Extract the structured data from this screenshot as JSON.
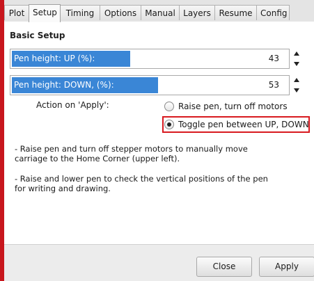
{
  "tabs": [
    {
      "label": "Plot",
      "active": false
    },
    {
      "label": "Setup",
      "active": true
    },
    {
      "label": "Timing",
      "active": false
    },
    {
      "label": "Options",
      "active": false
    },
    {
      "label": "Manual",
      "active": false
    },
    {
      "label": "Layers",
      "active": false
    },
    {
      "label": "Resume",
      "active": false
    },
    {
      "label": "Config",
      "active": false
    }
  ],
  "section_title": "Basic Setup",
  "pen_up": {
    "label": "Pen height: UP (%):",
    "value": "43",
    "percent": 43
  },
  "pen_down": {
    "label": "Pen height: DOWN, (%):",
    "value": "53",
    "percent": 53
  },
  "action": {
    "label": "Action on 'Apply':",
    "options": [
      {
        "label": "Raise pen, turn off motors",
        "checked": false
      },
      {
        "label": "Toggle pen between UP, DOWN",
        "checked": true
      }
    ]
  },
  "descriptions": [
    "- Raise pen and turn off stepper motors to manually move carriage to the Home Corner (upper left).",
    "- Raise and lower pen to check the vertical positions of the pen for writing and drawing."
  ],
  "buttons": {
    "close": "Close",
    "apply": "Apply"
  },
  "colors": {
    "slider_fill": "#3a86d6",
    "highlight": "#d8191f",
    "background_frame": "#c8161d"
  }
}
